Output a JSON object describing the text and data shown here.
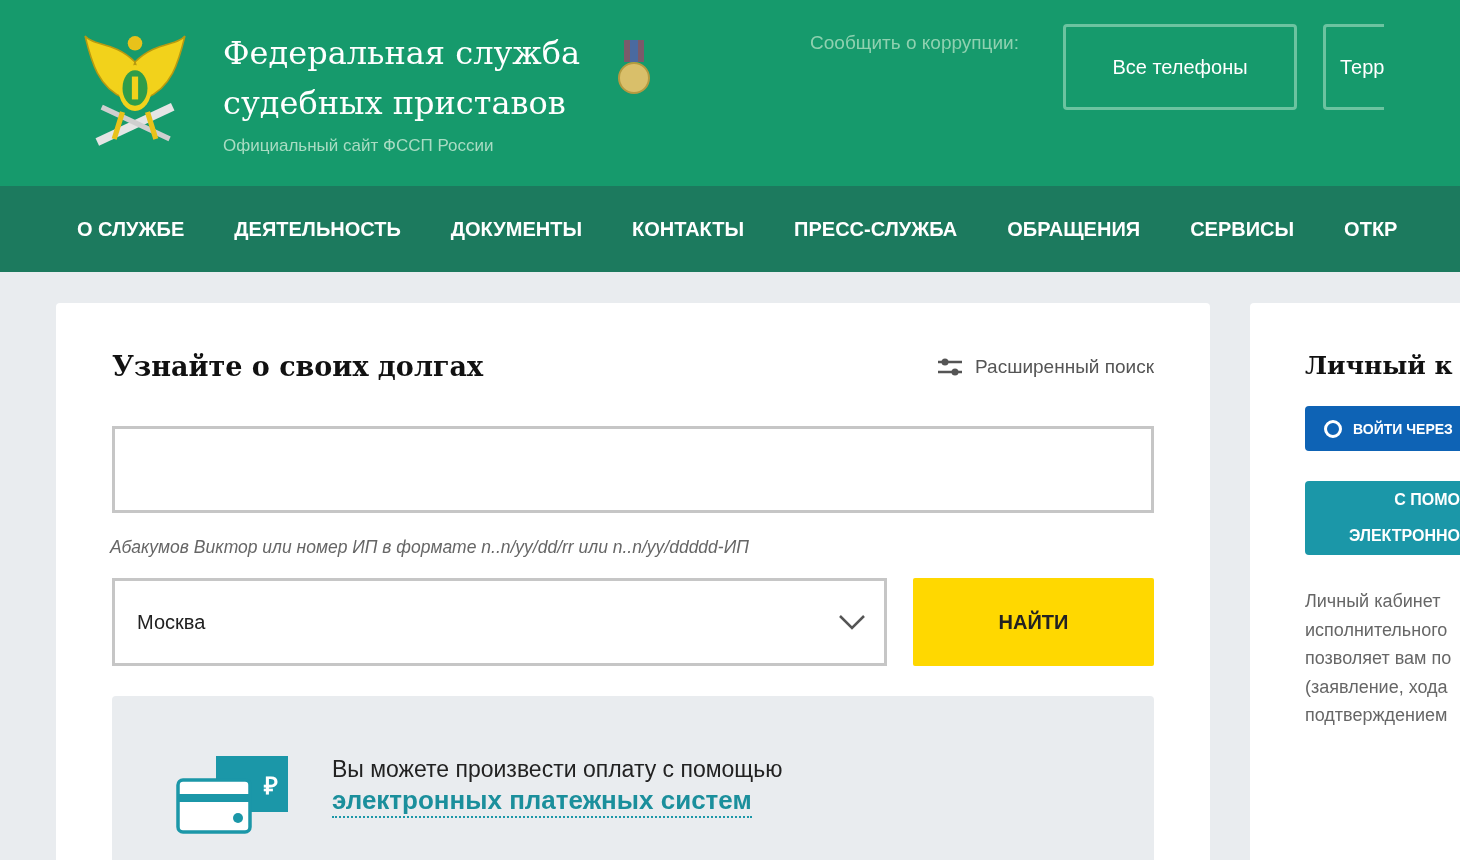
{
  "header": {
    "title_line_1": "Федеральная служба",
    "title_line_2": "судебных приставов",
    "subtitle": "Официальный сайт ФССП России",
    "corruption_label": "Сообщить о коррупции:",
    "buttons": [
      "Все телефоны",
      "Терр"
    ]
  },
  "nav": [
    "О СЛУЖБЕ",
    "ДЕЯТЕЛЬНОСТЬ",
    "ДОКУМЕНТЫ",
    "КОНТАКТЫ",
    "ПРЕСС-СЛУЖБА",
    "ОБРАЩЕНИЯ",
    "СЕРВИСЫ",
    "ОТКР"
  ],
  "search_card": {
    "title": "Узнайте о своих долгах",
    "advanced_search": "Расширенный поиск",
    "hint": "Абакумов Виктор или номер ИП в формате n..n/yy/dd/rr или n..n/yy/ddddd-ИП",
    "region": "Москва",
    "find_button": "НАЙТИ",
    "payment": {
      "icon_symbol": "₽",
      "text": "Вы можете произвести оплату с помощью",
      "link": "электронных платежных систем"
    }
  },
  "account_card": {
    "title": "Личный к",
    "login_button": "ВОЙТИ ЧЕРЕЗ",
    "signature_button_lines": [
      "С ПОМО",
      "ЭЛЕКТРОННО"
    ],
    "description_lines": [
      "Личный кабинет",
      "исполнительного",
      "позволяет вам по",
      "(заявление, хода",
      "подтверждением"
    ]
  }
}
